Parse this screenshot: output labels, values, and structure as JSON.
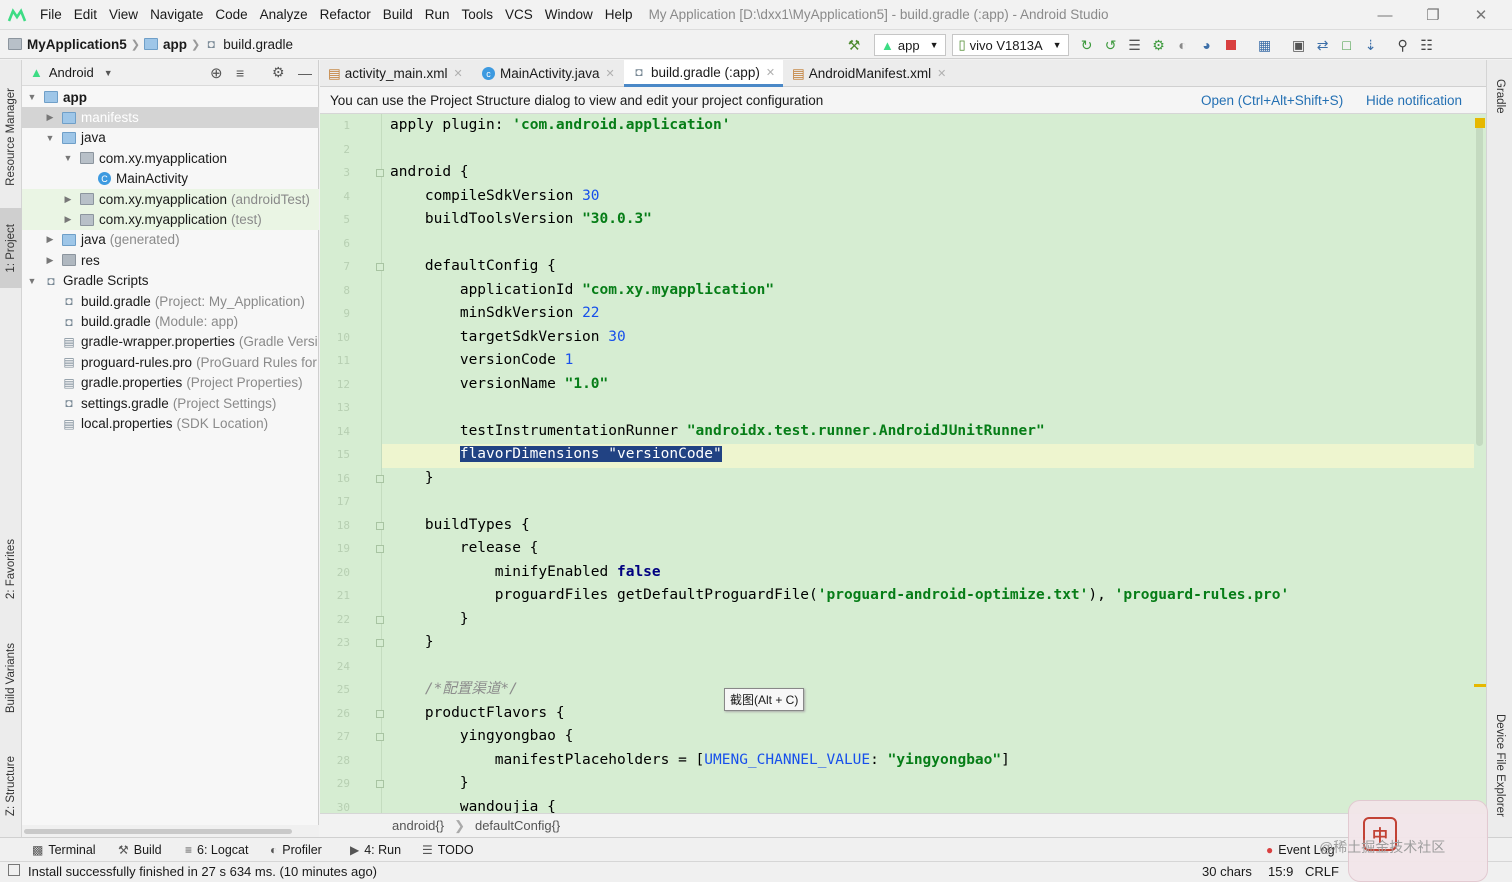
{
  "menu": {
    "items": [
      "File",
      "Edit",
      "View",
      "Navigate",
      "Code",
      "Analyze",
      "Refactor",
      "Build",
      "Run",
      "Tools",
      "VCS",
      "Window",
      "Help"
    ],
    "title": "My Application [D:\\dxx1\\MyApplication5] - build.gradle (:app) - Android Studio"
  },
  "nav": {
    "project": "MyApplication5",
    "module": "app",
    "file": "build.gradle",
    "run_config": "app",
    "device": "vivo V1813A"
  },
  "left_strip": {
    "resource_manager": "Resource Manager",
    "project": "1: Project",
    "favorites": "2: Favorites",
    "build_variants": "Build Variants",
    "structure": "Z: Structure"
  },
  "right_strip": {
    "gradle": "Gradle",
    "device_file_explorer": "Device File Explorer"
  },
  "project_panel": {
    "view": "Android",
    "tree": [
      {
        "label": "app",
        "hint": "",
        "depth": 0,
        "arrow": "open",
        "icon": "folder-app-icon",
        "bold": true
      },
      {
        "label": "manifests",
        "hint": "",
        "depth": 1,
        "arrow": "closed",
        "icon": "folder-icon",
        "bold": false
      },
      {
        "label": "java",
        "hint": "",
        "depth": 1,
        "arrow": "open",
        "icon": "folder-icon",
        "bold": false
      },
      {
        "label": "com.xy.myapplication",
        "hint": "",
        "depth": 2,
        "arrow": "open",
        "icon": "package-icon",
        "bold": false
      },
      {
        "label": "MainActivity",
        "hint": "",
        "depth": 3,
        "arrow": "none",
        "icon": "class-icon",
        "bold": false
      },
      {
        "label": "com.xy.myapplication",
        "hint": "(androidTest)",
        "depth": 2,
        "arrow": "closed",
        "icon": "package-icon",
        "bold": false
      },
      {
        "label": "com.xy.myapplication",
        "hint": "(test)",
        "depth": 2,
        "arrow": "closed",
        "icon": "package-icon",
        "bold": false
      },
      {
        "label": "java",
        "hint": "(generated)",
        "depth": 1,
        "arrow": "closed",
        "icon": "folder-gen-icon",
        "bold": false
      },
      {
        "label": "res",
        "hint": "",
        "depth": 1,
        "arrow": "closed",
        "icon": "folder-res-icon",
        "bold": false
      },
      {
        "label": "Gradle Scripts",
        "hint": "",
        "depth": 0,
        "arrow": "open",
        "icon": "gradle-icon",
        "bold": false
      },
      {
        "label": "build.gradle",
        "hint": "(Project: My_Application)",
        "depth": 1,
        "arrow": "none",
        "icon": "gradle-icon",
        "bold": false
      },
      {
        "label": "build.gradle",
        "hint": "(Module: app)",
        "depth": 1,
        "arrow": "none",
        "icon": "gradle-icon",
        "bold": false
      },
      {
        "label": "gradle-wrapper.properties",
        "hint": "(Gradle Versi",
        "depth": 1,
        "arrow": "none",
        "icon": "properties-icon",
        "bold": false
      },
      {
        "label": "proguard-rules.pro",
        "hint": "(ProGuard Rules for",
        "depth": 1,
        "arrow": "none",
        "icon": "properties-icon",
        "bold": false
      },
      {
        "label": "gradle.properties",
        "hint": "(Project Properties)",
        "depth": 1,
        "arrow": "none",
        "icon": "properties-icon",
        "bold": false
      },
      {
        "label": "settings.gradle",
        "hint": "(Project Settings)",
        "depth": 1,
        "arrow": "none",
        "icon": "gradle-icon",
        "bold": false
      },
      {
        "label": "local.properties",
        "hint": "(SDK Location)",
        "depth": 1,
        "arrow": "none",
        "icon": "properties-icon",
        "bold": false
      }
    ]
  },
  "tabs": [
    {
      "label": "activity_main.xml",
      "icon": "xml-icon"
    },
    {
      "label": "MainActivity.java",
      "icon": "class-icon"
    },
    {
      "label": "build.gradle (:app)",
      "icon": "gradle-icon"
    },
    {
      "label": "AndroidManifest.xml",
      "icon": "xml-icon"
    }
  ],
  "notification": {
    "text": "You can use the Project Structure dialog to view and edit your project configuration",
    "open": "Open (Ctrl+Alt+Shift+S)",
    "hide": "Hide notification"
  },
  "code_lines": [
    [
      [
        "apply ",
        ""
      ],
      [
        "plugin",
        ""
      ],
      [
        ": ",
        ""
      ],
      [
        "'com.android.application'",
        "str"
      ]
    ],
    [],
    [
      [
        "android {",
        ""
      ]
    ],
    [
      [
        "    compileSdkVersion ",
        ""
      ],
      [
        "30",
        "num"
      ]
    ],
    [
      [
        "    buildToolsVersion ",
        ""
      ],
      [
        "\"30.0.3\"",
        "str"
      ]
    ],
    [],
    [
      [
        "    defaultConfig {",
        ""
      ]
    ],
    [
      [
        "        applicationId ",
        ""
      ],
      [
        "\"com.xy.myapplication\"",
        "str"
      ]
    ],
    [
      [
        "        minSdkVersion ",
        ""
      ],
      [
        "22",
        "num"
      ]
    ],
    [
      [
        "        targetSdkVersion ",
        ""
      ],
      [
        "30",
        "num"
      ]
    ],
    [
      [
        "        versionCode ",
        ""
      ],
      [
        "1",
        "num"
      ]
    ],
    [
      [
        "        versionName ",
        ""
      ],
      [
        "\"1.0\"",
        "str"
      ]
    ],
    [],
    [
      [
        "        testInstrumentationRunner ",
        ""
      ],
      [
        "\"androidx.test.runner.AndroidJUnitRunner\"",
        "str"
      ]
    ],
    [
      [
        "        ",
        ""
      ],
      [
        "flavorDimensions \"versionCode\"",
        "sel"
      ]
    ],
    [
      [
        "    }",
        ""
      ]
    ],
    [],
    [
      [
        "    buildTypes {",
        ""
      ]
    ],
    [
      [
        "        release {",
        ""
      ]
    ],
    [
      [
        "            minifyEnabled ",
        ""
      ],
      [
        "false",
        "kw"
      ]
    ],
    [
      [
        "            proguardFiles getDefaultProguardFile(",
        ""
      ],
      [
        "'proguard-android-optimize.txt'",
        "str"
      ],
      [
        "), ",
        ""
      ],
      [
        "'proguard-rules.pro'",
        "str"
      ]
    ],
    [
      [
        "        }",
        ""
      ]
    ],
    [
      [
        "    }",
        ""
      ]
    ],
    [],
    [
      [
        "    ",
        ""
      ],
      [
        "/*配置渠道*/",
        "cmt"
      ]
    ],
    [
      [
        "    productFlavors {",
        ""
      ]
    ],
    [
      [
        "        yingyongbao {",
        ""
      ]
    ],
    [
      [
        "            manifestPlaceholders = [",
        ""
      ],
      [
        "UMENG_CHANNEL_VALUE",
        "num"
      ],
      [
        ": ",
        ""
      ],
      [
        "\"yingyongbao\"",
        "str"
      ],
      [
        "]",
        ""
      ]
    ],
    [
      [
        "        }",
        ""
      ]
    ],
    [
      [
        "        wandoujia {",
        ""
      ]
    ]
  ],
  "tooltip": "截图(Alt + C)",
  "breadcrumbs": [
    "android{}",
    "defaultConfig{}"
  ],
  "tool_windows": [
    {
      "label": "Terminal",
      "icon": "terminal-icon"
    },
    {
      "label": "Build",
      "icon": "hammer-icon"
    },
    {
      "label": "6: Logcat",
      "icon": "logcat-icon"
    },
    {
      "label": "Profiler",
      "icon": "profiler-icon"
    },
    {
      "label": "4: Run",
      "icon": "run-icon"
    },
    {
      "label": "TODO",
      "icon": "todo-icon"
    },
    {
      "label": "Event Log",
      "icon": "event-log-icon"
    }
  ],
  "status": {
    "message": "Install successfully finished in 27 s 634 ms. (10 minutes ago)",
    "chars": "30 chars",
    "position": "15:9",
    "line_sep": "CRLF"
  },
  "overlay": {
    "ime": "中",
    "watermark": "@稀土掘金技术社区"
  },
  "colors": {
    "editor_bg": "#d6edd2",
    "string": "#067d17",
    "number": "#1750eb",
    "selection": "#214283",
    "link": "#2470b3"
  }
}
